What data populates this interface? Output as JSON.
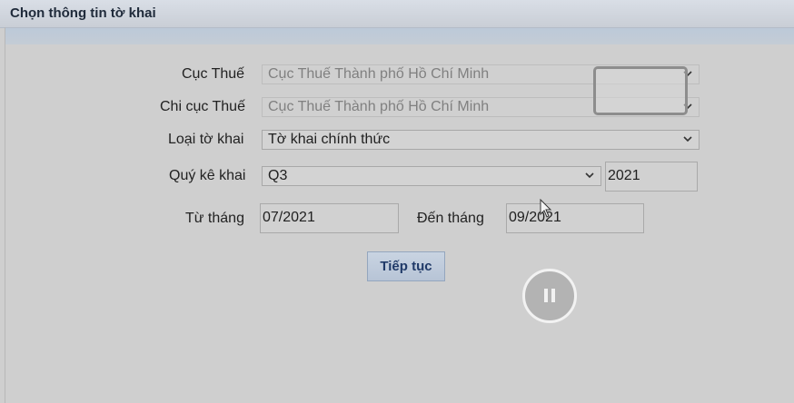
{
  "header": {
    "title": "Chọn thông tin tờ khai"
  },
  "form": {
    "cuc_thue": {
      "label": "Cục Thuế",
      "value": "Cục Thuế Thành phố Hồ Chí Minh"
    },
    "chi_cuc_thue": {
      "label": "Chi cục Thuế",
      "value": "Cục Thuế Thành phố Hồ Chí Minh"
    },
    "loai_to_khai": {
      "label": "Loại tờ khai",
      "value": "Tờ khai chính thức"
    },
    "quy_ke_khai": {
      "label": "Quý kê khai",
      "value": "Q3",
      "year": "2021"
    },
    "tu_thang": {
      "label": "Từ tháng",
      "value": "07/2021"
    },
    "den_thang": {
      "label": "Đến tháng",
      "value": "09/2021"
    }
  },
  "actions": {
    "continue_label": "Tiếp tục"
  },
  "media": {
    "pause_icon": "pause-icon"
  }
}
